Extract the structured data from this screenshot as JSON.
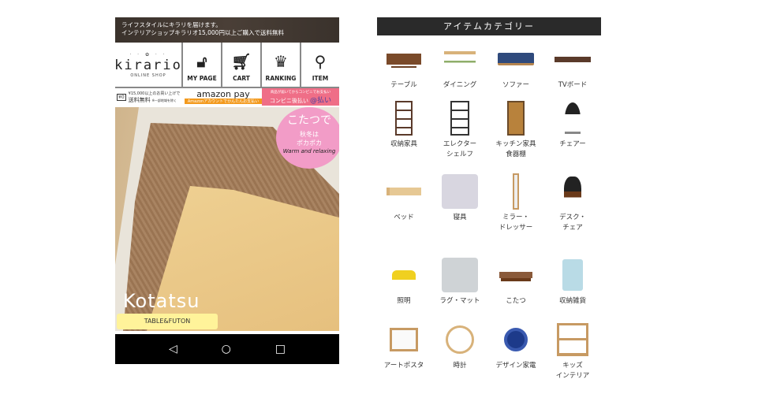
{
  "phone": {
    "topbar": [
      "ライフスタイルにキラリを届けます。",
      "インテリアショップキラリオ15,000円以上ご購入で送料無料"
    ],
    "logo": {
      "name": "kirario",
      "sub": "ONLINE SHOP"
    },
    "nav": [
      {
        "label": "MY PAGE",
        "icon": "lock-icon"
      },
      {
        "label": "CART",
        "icon": "cart-icon"
      },
      {
        "label": "RANKING",
        "icon": "crown-icon"
      },
      {
        "label": "ITEM",
        "icon": "search-icon"
      }
    ],
    "banners": {
      "shipping": {
        "line1": "¥15,000以上のお買い上げで",
        "line2": "送料無料",
        "note": "※一部地域を除く",
        "badge": "¥0"
      },
      "amazon": {
        "title": "amazon pay",
        "strip": "Amazonアカウントでかんたんお支払い"
      },
      "conveni": {
        "line1": "商品が届いてからコンビニでお支払い",
        "line2": "コンビニ後払い",
        "brand": "@払い"
      }
    },
    "hero": {
      "bubble_main": "こたつで",
      "bubble_sub1": "秋冬は",
      "bubble_sub2": "ポカポカ",
      "bubble_script": "Warm and relaxing",
      "title": "Kotatsu",
      "subtitle": "TABLE&FUTON"
    },
    "sysnav": [
      "back-icon",
      "home-icon",
      "recents-icon"
    ]
  },
  "categories": {
    "title": "アイテムカテゴリー",
    "items": [
      {
        "l1": "テーブル",
        "l2": ""
      },
      {
        "l1": "ダイニング",
        "l2": ""
      },
      {
        "l1": "ソファー",
        "l2": ""
      },
      {
        "l1": "TVボード",
        "l2": ""
      },
      {
        "l1": "収納家具",
        "l2": ""
      },
      {
        "l1": "エレクター",
        "l2": "シェルフ"
      },
      {
        "l1": "キッチン家具",
        "l2": "食器棚"
      },
      {
        "l1": "チェアー",
        "l2": ""
      },
      {
        "l1": "ベッド",
        "l2": ""
      },
      {
        "l1": "寝具",
        "l2": ""
      },
      {
        "l1": "ミラー・",
        "l2": "ドレッサー"
      },
      {
        "l1": "デスク・",
        "l2": "チェア"
      },
      {
        "l1": "照明",
        "l2": ""
      },
      {
        "l1": "ラグ・マット",
        "l2": ""
      },
      {
        "l1": "こたつ",
        "l2": ""
      },
      {
        "l1": "収納雑貨",
        "l2": ""
      },
      {
        "l1": "アートポスタ",
        "l2": ""
      },
      {
        "l1": "時計",
        "l2": ""
      },
      {
        "l1": "デザイン家電",
        "l2": ""
      },
      {
        "l1": "キッズ",
        "l2": "インテリア"
      }
    ]
  }
}
